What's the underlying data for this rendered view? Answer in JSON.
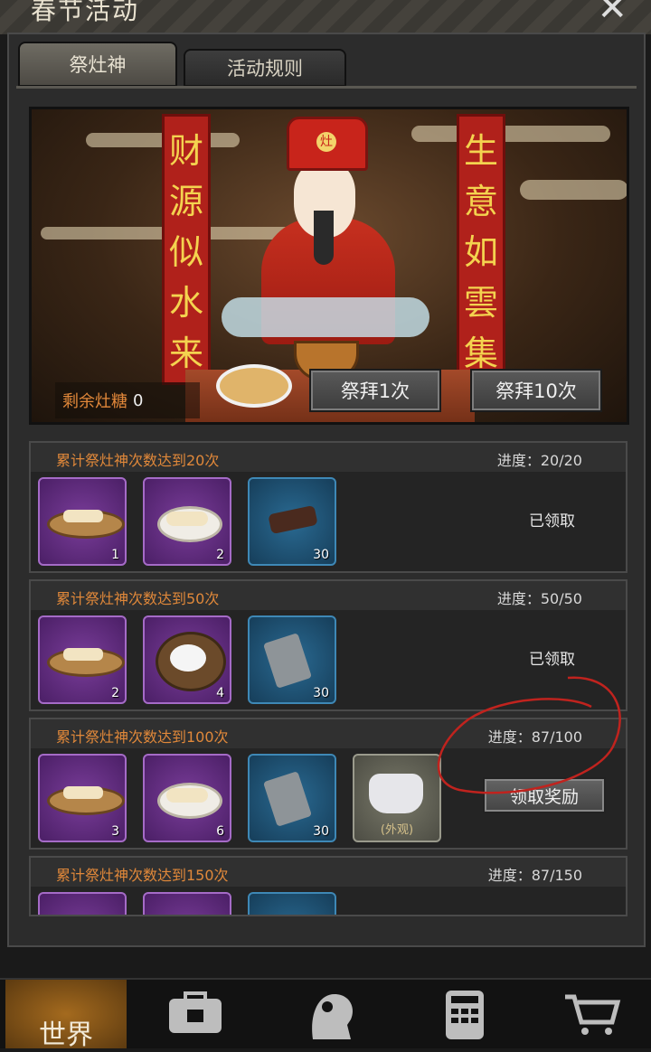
{
  "window": {
    "title": "春节活动",
    "close_glyph": "✕"
  },
  "tabs": [
    {
      "label": "祭灶神",
      "active": true
    },
    {
      "label": "活动规则",
      "active": false
    }
  ],
  "banner": {
    "left_couplet": "财源似水来",
    "right_couplet": "生意如雲集",
    "hat_char": "灶",
    "remaining_label": "剩余灶糖",
    "remaining_value": "0",
    "worship_1": "祭拜1次",
    "worship_10": "祭拜10次"
  },
  "rewards": [
    {
      "title": "累计祭灶神次数达到20次",
      "progress": "进度：20/20",
      "status": "已领取",
      "items": [
        {
          "icon": "sliced-cake-icon",
          "qty": "1",
          "rarity": "purple"
        },
        {
          "icon": "dumplings-icon",
          "qty": "2",
          "rarity": "purple"
        },
        {
          "icon": "chocolate-icon",
          "qty": "30",
          "rarity": "blue"
        }
      ]
    },
    {
      "title": "累计祭灶神次数达到50次",
      "progress": "进度：50/50",
      "status": "已领取",
      "items": [
        {
          "icon": "sliced-cake-icon",
          "qty": "2",
          "rarity": "purple"
        },
        {
          "icon": "rice-balls-bowl-icon",
          "qty": "4",
          "rarity": "purple"
        },
        {
          "icon": "stone-fragment-icon",
          "qty": "30",
          "rarity": "blue"
        }
      ]
    },
    {
      "title": "累计祭灶神次数达到100次",
      "progress": "进度：87/100",
      "button": "领取奖励",
      "items": [
        {
          "icon": "sliced-cake-icon",
          "qty": "3",
          "rarity": "purple"
        },
        {
          "icon": "dumplings-icon",
          "qty": "6",
          "rarity": "purple"
        },
        {
          "icon": "stone-fragment-icon",
          "qty": "30",
          "rarity": "blue"
        },
        {
          "icon": "boots-icon",
          "qty": "",
          "rarity": "gray",
          "badge": "(外观)"
        }
      ]
    },
    {
      "title": "累计祭灶神次数达到150次",
      "progress": "进度：87/150"
    }
  ],
  "nav": {
    "world_label": "世界"
  },
  "annotation_color": "#c0231e"
}
